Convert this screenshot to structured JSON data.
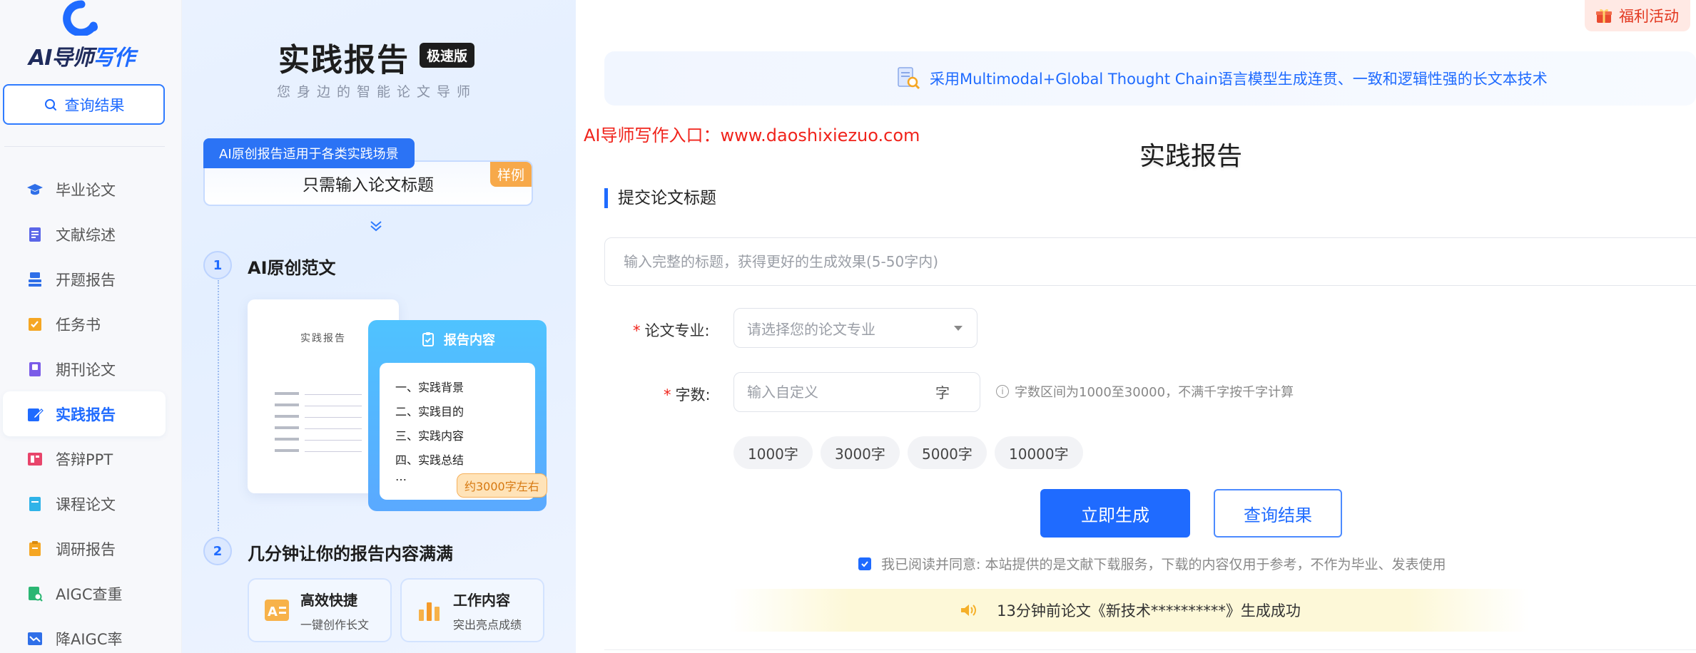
{
  "brand": {
    "logo_prefix": "AI",
    "logo_main": "导师",
    "logo_accent": "写作"
  },
  "sidebar": {
    "search_label": "查询结果",
    "items": [
      {
        "label": "毕业论文",
        "icon": "graduation-cap-icon",
        "color": "#2f6fe8"
      },
      {
        "label": "文献综述",
        "icon": "document-icon",
        "color": "#5b66e8"
      },
      {
        "label": "开题报告",
        "icon": "stack-icon",
        "color": "#2f6fe8"
      },
      {
        "label": "任务书",
        "icon": "checklist-icon",
        "color": "#f5a623"
      },
      {
        "label": "期刊论文",
        "icon": "book-icon",
        "color": "#7b5ce8"
      },
      {
        "label": "实践报告",
        "icon": "edit-icon",
        "color": "#1f6bff",
        "active": true
      },
      {
        "label": "答辩PPT",
        "icon": "ppt-icon",
        "color": "#e8456b"
      },
      {
        "label": "课程论文",
        "icon": "notebook-icon",
        "color": "#2fb3e8"
      },
      {
        "label": "调研报告",
        "icon": "clipboard-icon",
        "color": "#f5a623"
      },
      {
        "label": "AIGC查重",
        "icon": "scan-icon",
        "color": "#2bb673"
      },
      {
        "label": "降AIGC率",
        "icon": "chart-down-icon",
        "color": "#2f6fe8"
      }
    ]
  },
  "intro": {
    "title": "实践报告",
    "badge": "极速版",
    "subtitle": "您身边的智能论文导师",
    "tagbar": "AI原创报告适用于各类实践场景",
    "input_text": "只需输入论文标题",
    "sample_tag": "样例",
    "step1": {
      "num": "1",
      "title": "AI原创范文"
    },
    "step2": {
      "num": "2",
      "title": "几分钟让你的报告内容满满"
    },
    "doc_title": "实践报告",
    "content_card": {
      "title": "报告内容",
      "items": [
        "一、实践背景",
        "二、实践目的",
        "三、实践内容",
        "四、实践总结"
      ],
      "ellipsis": "…",
      "badge": "约3000字左右"
    },
    "features": [
      {
        "title": "高效快捷",
        "sub": "一键创作长文"
      },
      {
        "title": "工作内容",
        "sub": "突出亮点成绩"
      }
    ]
  },
  "main": {
    "promo": "福利活动",
    "tech_banner": "采用Multimodal+Global Thought Chain语言模型生成连贯、一致和逻辑性强的长文本技术",
    "entry_text": "AI导师写作入口：www.daoshixiezuo.com",
    "page_title": "实践报告",
    "section_title": "提交论文标题",
    "title_placeholder": "输入完整的标题，获得更好的生成效果(5-50字内)",
    "major_label": "论文专业:",
    "major_placeholder": "请选择您的论文专业",
    "word_label": "字数:",
    "word_placeholder": "输入自定义",
    "word_unit": "字",
    "word_hint": "字数区间为1000至30000，不满千字按千字计算",
    "word_chips": [
      "1000字",
      "3000字",
      "5000字",
      "10000字"
    ],
    "generate_btn": "立即生成",
    "query_btn": "查询结果",
    "agreement": "我已阅读并同意: 本站提供的是文献下载服务，下载的内容仅用于参考，不作为毕业、发表使用",
    "agreement_checked": true,
    "notice": "13分钟前论文《新技术**********》生成成功"
  }
}
